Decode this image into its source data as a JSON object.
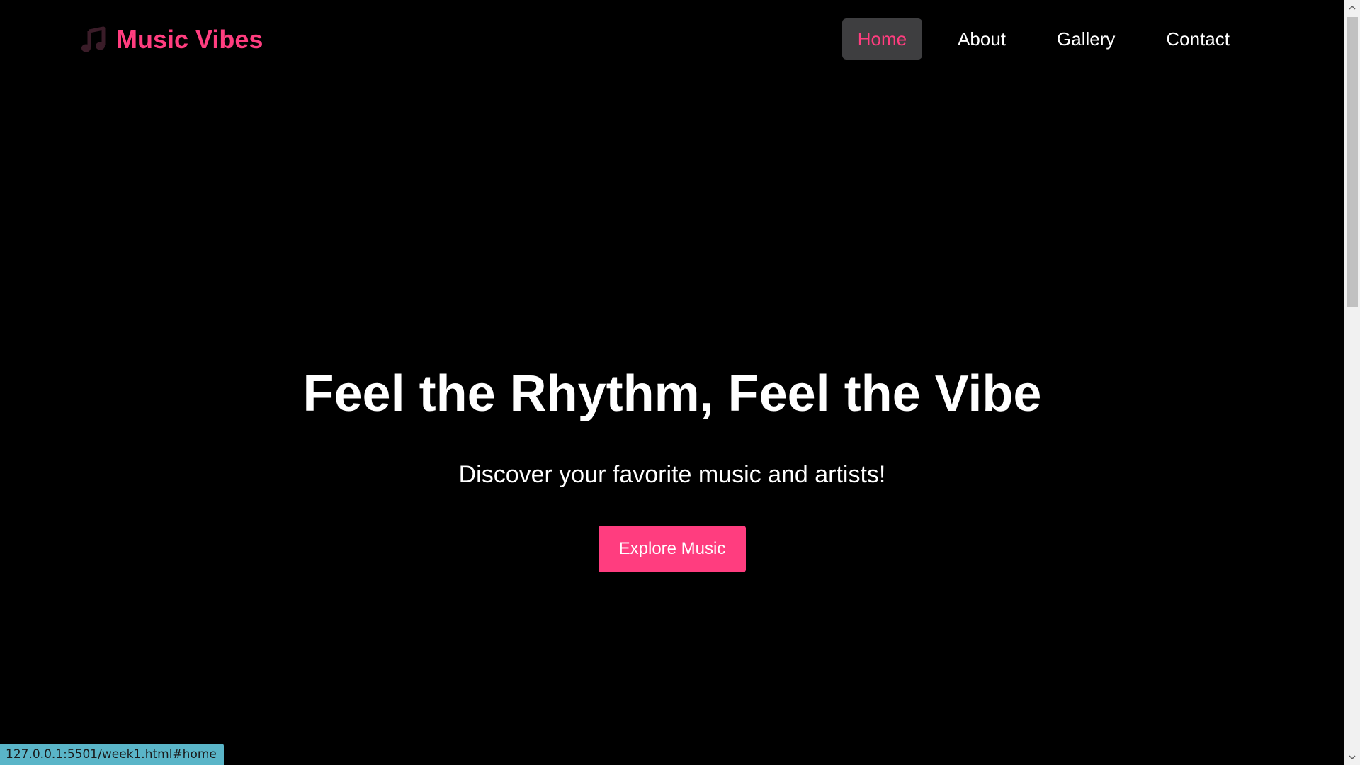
{
  "header": {
    "logo_icon": "music-note-icon",
    "logo_text": "Music Vibes",
    "nav": [
      {
        "label": "Home",
        "active": true
      },
      {
        "label": "About",
        "active": false
      },
      {
        "label": "Gallery",
        "active": false
      },
      {
        "label": "Contact",
        "active": false
      }
    ]
  },
  "hero": {
    "title": "Feel the Rhythm, Feel the Vibe",
    "subtitle": "Discover your favorite music and artists!",
    "cta_label": "Explore Music"
  },
  "status_bar": {
    "url": "127.0.0.1:5501/week1.html#home"
  },
  "colors": {
    "accent": "#ff3d7f",
    "background": "#000000",
    "active_nav_bg": "#3e3e40",
    "status_bar_bg": "#5ab5c8"
  }
}
